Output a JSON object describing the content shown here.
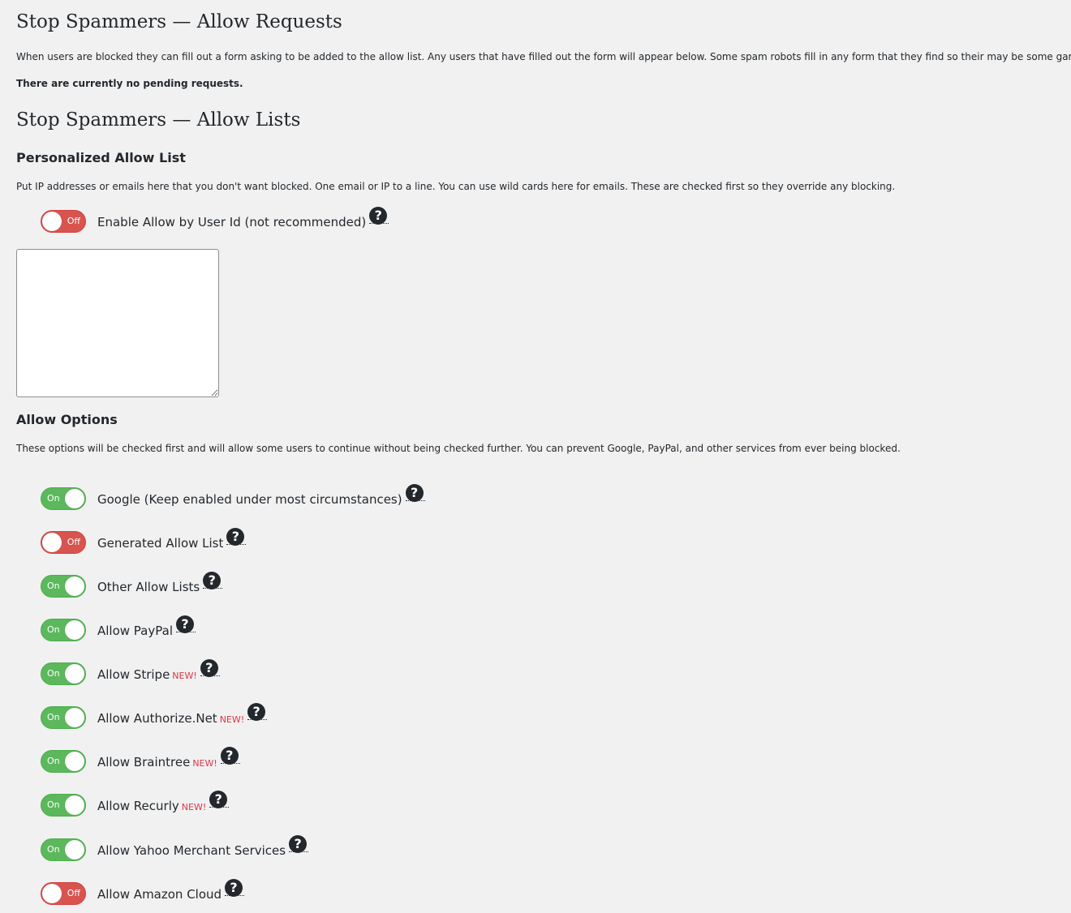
{
  "requests": {
    "title": "Stop Spammers — Allow Requests",
    "description": "When users are blocked they can fill out a form asking to be added to the allow list. Any users that have filled out the form will appear below. Some spam robots fill in any form that they find so their may be some garbage here.",
    "status": "There are currently no pending requests."
  },
  "lists": {
    "title": "Stop Spammers — Allow Lists",
    "personalized": {
      "heading": "Personalized Allow List",
      "description": "Put IP addresses or emails here that you don't want blocked. One email or IP to a line. You can use wild cards here for emails. These are checked first so they override any blocking.",
      "textarea_value": "",
      "user_id_toggle": {
        "label": "Enable Allow by User Id (not recommended)",
        "state": "Off"
      }
    },
    "options": {
      "heading": "Allow Options",
      "description": "These options will be checked first and will allow some users to continue without being checked further. You can prevent Google, PayPal, and other services from ever being blocked.",
      "new_tag": "NEW!",
      "help_glyph": "?",
      "items": [
        {
          "label": "Google (Keep enabled under most circumstances)",
          "state": "On",
          "new": false
        },
        {
          "label": "Generated Allow List",
          "state": "Off",
          "new": false
        },
        {
          "label": "Other Allow Lists",
          "state": "On",
          "new": false
        },
        {
          "label": "Allow PayPal",
          "state": "On",
          "new": false
        },
        {
          "label": "Allow Stripe",
          "state": "On",
          "new": true
        },
        {
          "label": "Allow Authorize.Net",
          "state": "On",
          "new": true
        },
        {
          "label": "Allow Braintree",
          "state": "On",
          "new": true
        },
        {
          "label": "Allow Recurly",
          "state": "On",
          "new": true
        },
        {
          "label": "Allow Yahoo Merchant Services",
          "state": "On",
          "new": false
        },
        {
          "label": "Allow Amazon Cloud",
          "state": "Off",
          "new": false
        }
      ]
    }
  },
  "colors": {
    "on": "#5cb85c",
    "off": "#d9534f",
    "new_tag": "#dc3545",
    "background": "#f1f1f1"
  }
}
